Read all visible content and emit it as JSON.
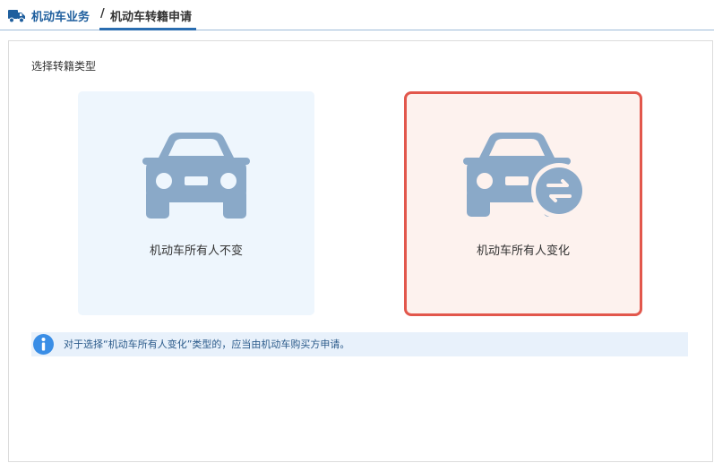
{
  "breadcrumb": {
    "parent": "机动车业务",
    "separator": "/",
    "current": "机动车转籍申请"
  },
  "section": {
    "label": "选择转籍类型"
  },
  "options": [
    {
      "label": "机动车所有人不变",
      "icon": "car-icon",
      "selected": false
    },
    {
      "label": "机动车所有人变化",
      "icon": "car-transfer-icon",
      "selected": true
    }
  ],
  "notice": {
    "icon": "info-icon",
    "text": "对于选择“机动车所有人变化”类型的，应当由机动车购买方申请。"
  },
  "colors": {
    "brand": "#1f5f9e",
    "icon": "#8aa9c8",
    "selected_border": "#e2574c",
    "card_default_bg": "#eef6fd",
    "card_selected_bg": "#fdf2ee",
    "notice_bg": "#e8f1fb",
    "info_icon": "#3a8ee6"
  }
}
